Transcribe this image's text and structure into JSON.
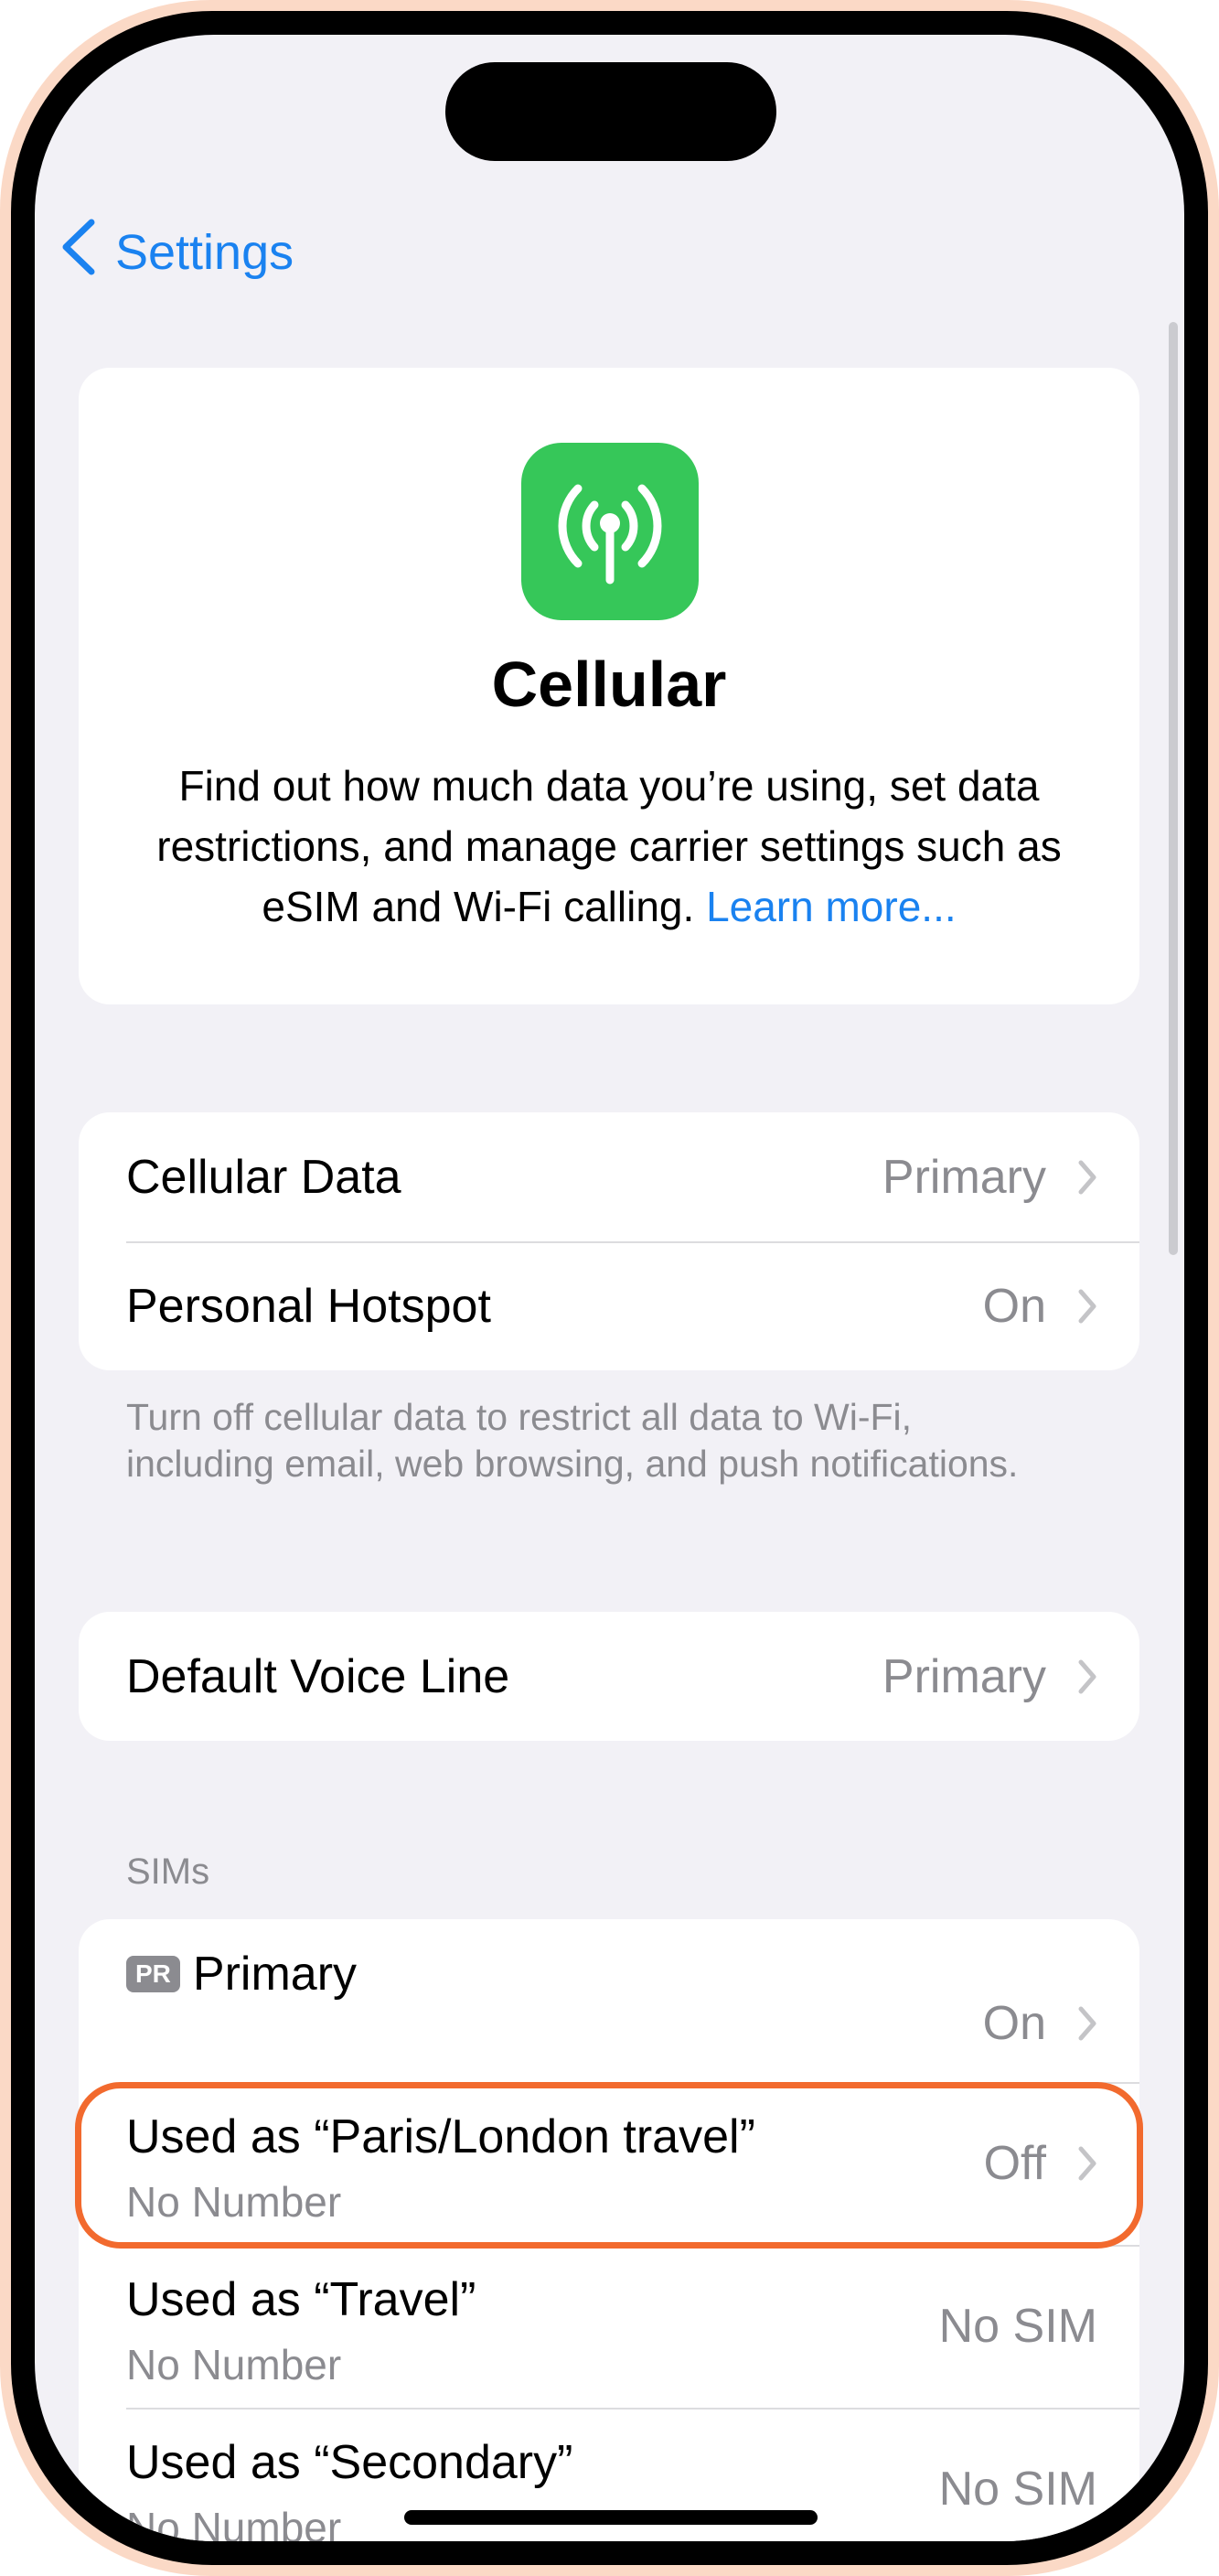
{
  "nav": {
    "back_label": "Settings"
  },
  "hero": {
    "title": "Cellular",
    "description": "Find out how much data you’re using, set data restrictions, and manage carrier settings such as eSIM and Wi-Fi calling.",
    "link_text": "Learn more...",
    "icon": "antenna-icon",
    "icon_color": "#36c759"
  },
  "group1": {
    "rows": [
      {
        "label": "Cellular Data",
        "value": "Primary"
      },
      {
        "label": "Personal Hotspot",
        "value": "On"
      }
    ],
    "footer": "Turn off cellular data to restrict all data to Wi-Fi, including email, web browsing, and push notifications."
  },
  "group2": {
    "rows": [
      {
        "label": "Default Voice Line",
        "value": "Primary"
      }
    ]
  },
  "sims": {
    "header": "SIMs",
    "rows": [
      {
        "badge": "PR",
        "label": "Primary",
        "value": "On"
      },
      {
        "label": "Used as “Paris/London travel”",
        "sublabel": "No Number",
        "value": "Off"
      },
      {
        "label": "Used as “Travel”",
        "sublabel": "No Number",
        "value": "No SIM"
      },
      {
        "label": "Used as “Secondary”",
        "sublabel": "No Number",
        "value": "No SIM"
      }
    ]
  },
  "colors": {
    "accent": "#1a82f0",
    "highlight": "#f26a2e",
    "background": "#f2f1f6"
  }
}
